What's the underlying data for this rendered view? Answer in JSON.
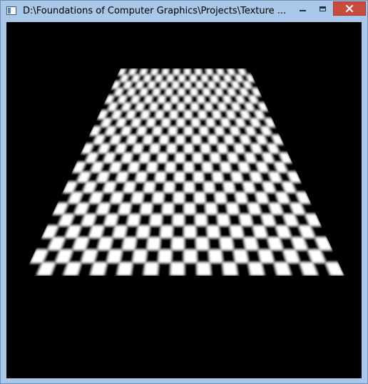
{
  "window": {
    "title": "D:\\Foundations of Computer Graphics\\Projects\\Texture ...",
    "icon": "console-window-icon",
    "controls": {
      "minimize_icon": "minimize-icon",
      "maximize_icon": "maximize-icon",
      "close_icon": "close-icon"
    }
  },
  "viewport": {
    "background_color": "#000000",
    "scene": "perspective-textured-plane",
    "texture": {
      "pattern": "checkerboard",
      "colors": [
        "#000000",
        "#ffffff"
      ],
      "columns": 24,
      "rows": 22
    }
  },
  "colors": {
    "titlebar": "#a9c7e8",
    "close_button": "#c74b3f"
  }
}
